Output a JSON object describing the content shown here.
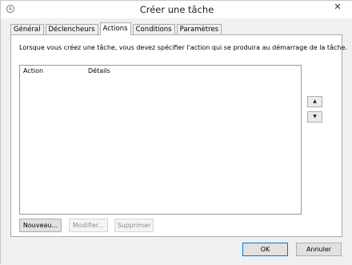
{
  "window": {
    "title": "Créer une tâche",
    "close_glyph": "✕"
  },
  "tabs": [
    {
      "label": "Général"
    },
    {
      "label": "Déclencheurs"
    },
    {
      "label": "Actions",
      "active": true
    },
    {
      "label": "Conditions"
    },
    {
      "label": "Paramètres"
    }
  ],
  "panel": {
    "description": "Lorsque vous créez une tâche, vous devez spécifier l'action qui se produira au démarrage de la tâche.",
    "columns": {
      "action": "Action",
      "details": "Détails"
    },
    "move_up_glyph": "▲",
    "move_down_glyph": "▼"
  },
  "buttons": {
    "new": "Nouveau...",
    "edit": "Modifier...",
    "delete": "Supprimer",
    "ok": "OK",
    "cancel": "Annuler"
  }
}
